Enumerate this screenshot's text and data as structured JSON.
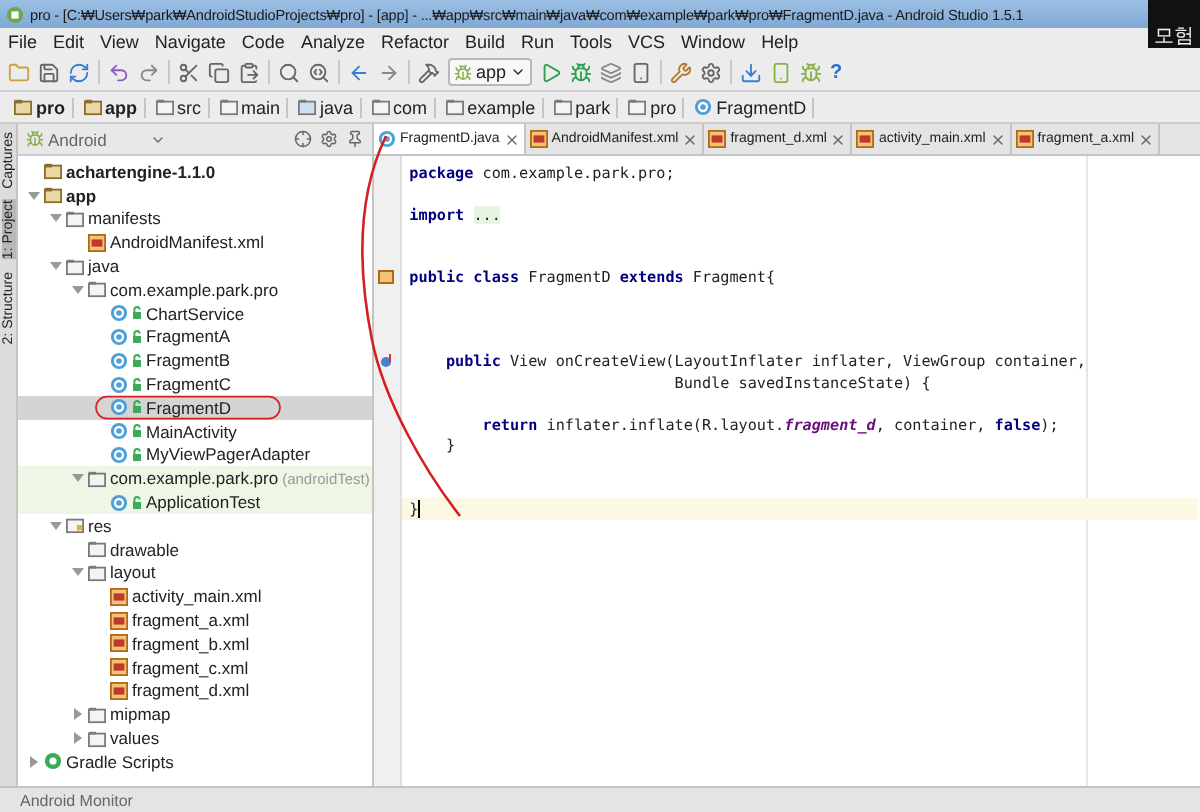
{
  "window": {
    "title": "pro - [C:₩Users₩park₩AndroidStudioProjects₩pro] - [app] - ...₩app₩src₩main₩java₩com₩example₩park₩pro₩FragmentD.java - Android Studio 1.5.1",
    "overlay_label": "모험"
  },
  "menu": [
    "File",
    "Edit",
    "View",
    "Navigate",
    "Code",
    "Analyze",
    "Refactor",
    "Build",
    "Run",
    "Tools",
    "VCS",
    "Window",
    "Help"
  ],
  "toolbar": {
    "config": "app",
    "help": "?"
  },
  "breadcrumb": [
    {
      "label": "pro",
      "kind": "module"
    },
    {
      "label": "app",
      "kind": "module"
    },
    {
      "label": "src",
      "kind": "folder"
    },
    {
      "label": "main",
      "kind": "folder"
    },
    {
      "label": "java",
      "kind": "source"
    },
    {
      "label": "com",
      "kind": "folder"
    },
    {
      "label": "example",
      "kind": "folder"
    },
    {
      "label": "park",
      "kind": "folder"
    },
    {
      "label": "pro",
      "kind": "folder"
    },
    {
      "label": "FragmentD",
      "kind": "class"
    }
  ],
  "side_tabs": [
    {
      "label": "Captures",
      "selected": false
    },
    {
      "label": "1: Project",
      "selected": true
    },
    {
      "label": "2: Structure",
      "selected": false
    }
  ],
  "project_view": "Android",
  "tree": [
    {
      "label": "achartengine-1.1.0",
      "kind": "module",
      "selected": false
    },
    {
      "label": "app",
      "kind": "module",
      "expanded": true,
      "selected": false,
      "children": [
        {
          "label": "manifests",
          "kind": "folder",
          "expanded": true,
          "selected": false,
          "children": [
            {
              "label": "AndroidManifest.xml",
              "kind": "xml",
              "selected": false
            }
          ]
        },
        {
          "label": "java",
          "kind": "folder",
          "expanded": true,
          "selected": false,
          "children": [
            {
              "label": "com.example.park.pro",
              "kind": "package",
              "expanded": true,
              "selected": false,
              "children": [
                {
                  "label": "ChartService",
                  "kind": "class",
                  "selected": false
                },
                {
                  "label": "FragmentA",
                  "kind": "class",
                  "selected": false
                },
                {
                  "label": "FragmentB",
                  "kind": "class",
                  "selected": false
                },
                {
                  "label": "FragmentC",
                  "kind": "class",
                  "selected": false
                },
                {
                  "label": "FragmentD",
                  "kind": "class",
                  "selected": true
                },
                {
                  "label": "MainActivity",
                  "kind": "class",
                  "selected": false
                },
                {
                  "label": "MyViewPagerAdapter",
                  "kind": "class",
                  "selected": false
                }
              ]
            },
            {
              "label": "com.example.park.pro",
              "suffix": "(androidTest)",
              "kind": "test-package",
              "expanded": true,
              "selected": false,
              "children": [
                {
                  "label": "ApplicationTest",
                  "kind": "test-class",
                  "selected": false
                }
              ]
            }
          ]
        },
        {
          "label": "res",
          "kind": "res",
          "expanded": true,
          "selected": false,
          "children": [
            {
              "label": "drawable",
              "kind": "folder",
              "selected": false
            },
            {
              "label": "layout",
              "kind": "folder",
              "expanded": true,
              "selected": false,
              "children": [
                {
                  "label": "activity_main.xml",
                  "kind": "xml",
                  "selected": false
                },
                {
                  "label": "fragment_a.xml",
                  "kind": "xml",
                  "selected": false
                },
                {
                  "label": "fragment_b.xml",
                  "kind": "xml",
                  "selected": false
                },
                {
                  "label": "fragment_c.xml",
                  "kind": "xml",
                  "selected": false
                },
                {
                  "label": "fragment_d.xml",
                  "kind": "xml",
                  "selected": false
                }
              ]
            },
            {
              "label": "mipmap",
              "kind": "folder",
              "expanded": false,
              "selected": false
            },
            {
              "label": "values",
              "kind": "folder",
              "expanded": false,
              "selected": false
            }
          ]
        }
      ]
    },
    {
      "label": "Gradle Scripts",
      "kind": "gradle",
      "expanded": false,
      "selected": false
    }
  ],
  "editor_tabs": [
    {
      "label": "FragmentD.java",
      "kind": "class",
      "selected": true
    },
    {
      "label": "AndroidManifest.xml",
      "kind": "xml",
      "selected": false
    },
    {
      "label": "fragment_d.xml",
      "kind": "xml",
      "selected": false
    },
    {
      "label": "activity_main.xml",
      "kind": "xml",
      "selected": false
    },
    {
      "label": "fragment_a.xml",
      "kind": "xml",
      "selected": false
    }
  ],
  "code": [
    {
      "kind": "code",
      "segments": [
        {
          "text": "package",
          "kind": "keyword"
        },
        {
          "text": " com.example.park.pro;",
          "kind": "plain"
        }
      ]
    },
    {
      "kind": "blank"
    },
    {
      "kind": "code",
      "segments": [
        {
          "text": "import ",
          "kind": "keyword"
        },
        {
          "text": "...",
          "kind": "folded"
        }
      ]
    },
    {
      "kind": "blank"
    },
    {
      "kind": "blank"
    },
    {
      "kind": "class-line",
      "segments": [
        {
          "text": "public class",
          "kind": "keyword"
        },
        {
          "text": " FragmentD ",
          "kind": "plain"
        },
        {
          "text": "extends",
          "kind": "keyword"
        },
        {
          "text": " Fragment{",
          "kind": "plain"
        }
      ]
    },
    {
      "kind": "blank"
    },
    {
      "kind": "blank"
    },
    {
      "kind": "blank"
    },
    {
      "kind": "override-line",
      "segments": [
        {
          "text": "    public",
          "kind": "keyword"
        },
        {
          "text": " View onCreateView(LayoutInflater inflater, ViewGroup container,",
          "kind": "plain"
        }
      ]
    },
    {
      "kind": "code",
      "segments": [
        {
          "text": "                             Bundle savedInstanceState) {",
          "kind": "plain"
        }
      ]
    },
    {
      "kind": "blank"
    },
    {
      "kind": "code",
      "segments": [
        {
          "text": "        return",
          "kind": "keyword"
        },
        {
          "text": " inflater.inflate(R.layout.",
          "kind": "plain"
        },
        {
          "text": "fragment_d",
          "kind": "field"
        },
        {
          "text": ", container, ",
          "kind": "plain"
        },
        {
          "text": "false",
          "kind": "keyword"
        },
        {
          "text": ");",
          "kind": "plain"
        }
      ]
    },
    {
      "kind": "code",
      "segments": [
        {
          "text": "    }",
          "kind": "plain"
        }
      ]
    },
    {
      "kind": "blank"
    },
    {
      "kind": "blank"
    },
    {
      "kind": "code",
      "current": true,
      "segments": [
        {
          "text": "}",
          "kind": "plain"
        }
      ]
    }
  ],
  "bottom_bar": "Android Monitor"
}
